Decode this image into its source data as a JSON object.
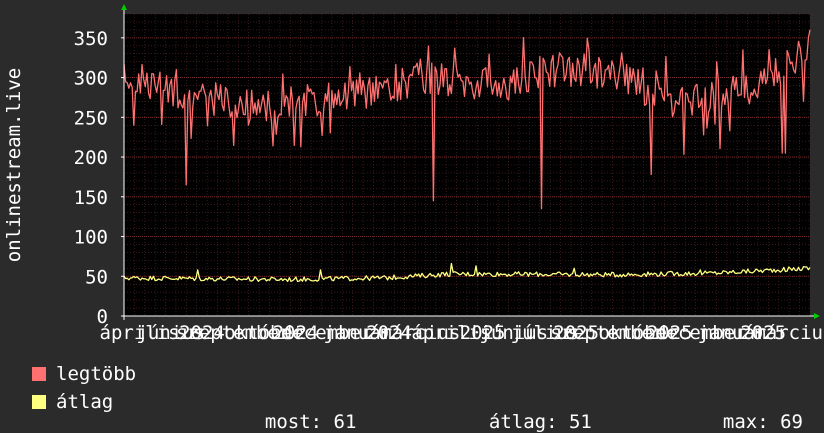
{
  "colors": {
    "background": "#2b2b2b",
    "plot_background": "#000000",
    "grid": "#5a2a2a",
    "axis": "#ffffff",
    "arrow": "#00cc00",
    "max_series": "#ff7070",
    "avg_series": "#ffff80"
  },
  "chart_data": {
    "type": "line",
    "ylabel": "onlinestream.live",
    "ylim": [
      0,
      380
    ],
    "yticks": [
      0,
      50,
      100,
      150,
      200,
      250,
      300,
      350
    ],
    "ytick_labels": [
      "0",
      "50",
      "100",
      "150",
      "200",
      "250",
      "300",
      "350"
    ],
    "xtick_labels": [
      "április",
      "június",
      "2024",
      "szeptember",
      "október",
      "2024",
      "december",
      "január",
      "2024",
      "március",
      "április",
      "2025",
      "június",
      "július",
      "2025",
      "szeptember",
      "október",
      "2025",
      "december",
      "január",
      "2025",
      "március"
    ],
    "grid": true,
    "x_points": 420,
    "series": [
      {
        "name": "legtöbb",
        "color": "#ff7070",
        "base_segments": [
          [
            0,
            300
          ],
          [
            40,
            280
          ],
          [
            80,
            265
          ],
          [
            140,
            275
          ],
          [
            180,
            300
          ],
          [
            230,
            290
          ],
          [
            260,
            310
          ],
          [
            300,
            305
          ],
          [
            340,
            265
          ],
          [
            380,
            285
          ],
          [
            419,
            335
          ]
        ],
        "amplitude": 22,
        "dips": [
          [
            38,
            165
          ],
          [
            189,
            145
          ],
          [
            255,
            135
          ],
          [
            322,
            178
          ],
          [
            402,
            205
          ],
          [
            404,
            205
          ]
        ],
        "end_value": 360
      },
      {
        "name": "átlag",
        "color": "#ffff80",
        "base_segments": [
          [
            0,
            48
          ],
          [
            100,
            46
          ],
          [
            160,
            48
          ],
          [
            200,
            53
          ],
          [
            300,
            52
          ],
          [
            360,
            54
          ],
          [
            419,
            60
          ]
        ],
        "amplitude": 3,
        "spikes": [
          [
            45,
            58
          ],
          [
            120,
            58
          ],
          [
            200,
            66
          ],
          [
            215,
            63
          ],
          [
            275,
            60
          ],
          [
            352,
            58
          ],
          [
            415,
            62
          ]
        ],
        "end_value": 61
      }
    ]
  },
  "legend": {
    "items": [
      {
        "label": "legtöbb",
        "color": "#ff7070"
      },
      {
        "label": "átlag",
        "color": "#ffff80"
      }
    ],
    "stats": {
      "now_label": "most:",
      "now_value": "61",
      "avg_label": "átlag:",
      "avg_value": "51",
      "max_label": "max:",
      "max_value": "69"
    }
  }
}
